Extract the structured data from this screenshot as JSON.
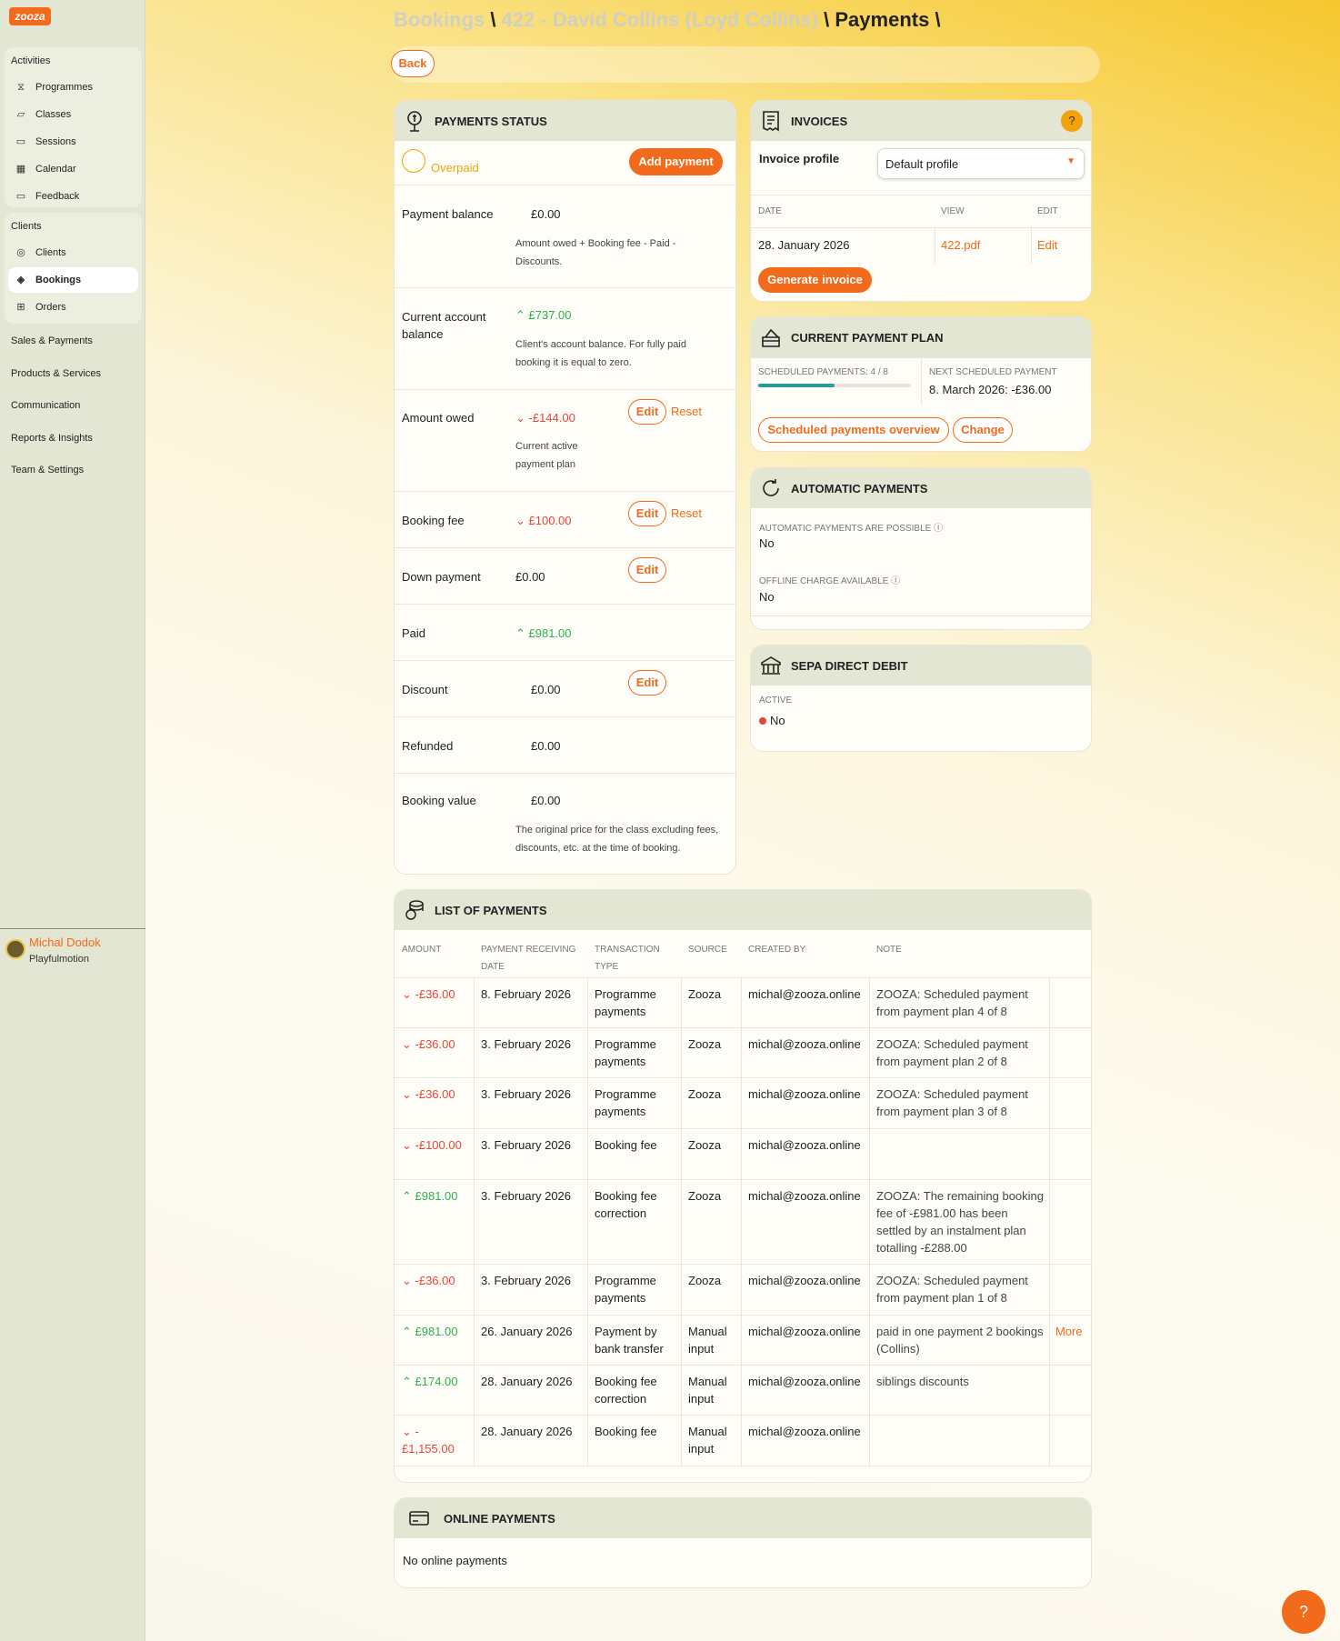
{
  "sidebar": {
    "logo": "zooza",
    "groups": [
      {
        "head": "Activities",
        "items": [
          "Programmes",
          "Classes",
          "Sessions",
          "Calendar",
          "Feedback"
        ]
      },
      {
        "head": "Clients",
        "items": [
          "Clients",
          "Bookings",
          "Orders"
        ]
      }
    ],
    "plain": [
      "Sales & Payments",
      "Products & Services",
      "Communication",
      "Reports & Insights",
      "Team & Settings"
    ],
    "user_name": "Michal Dodok",
    "user_org": "Playfulmotion"
  },
  "breadcrumbs": {
    "part1": "Bookings",
    "sep1": "\\",
    "part2": "422 - David Collins (Loyd Collins)",
    "sep2": "\\",
    "part3": "Payments",
    "sep3": "\\"
  },
  "back_label": "Back",
  "payments_status": {
    "title": "PAYMENTS STATUS",
    "status": "Overpaid",
    "add_payment": "Add payment",
    "rows": {
      "balance": {
        "label": "Payment balance",
        "value": "£0.00",
        "note": "Amount owed + Booking fee - Paid - Discounts."
      },
      "account": {
        "label": "Current account balance",
        "value": "£737.00",
        "note": "Client's account balance. For fully paid booking it is equal to zero."
      },
      "owed": {
        "label": "Amount owed",
        "value": "-£144.00",
        "note": "Current active payment plan",
        "edit": "Edit",
        "reset": "Reset"
      },
      "fee": {
        "label": "Booking fee",
        "value": "£100.00",
        "edit": "Edit",
        "reset": "Reset"
      },
      "down": {
        "label": "Down payment",
        "value": "£0.00",
        "edit": "Edit"
      },
      "paid": {
        "label": "Paid",
        "value": "£981.00"
      },
      "discount": {
        "label": "Discount",
        "value": "£0.00",
        "edit": "Edit"
      },
      "refunded": {
        "label": "Refunded",
        "value": "£0.00"
      },
      "value": {
        "label": "Booking value",
        "value": "£0.00",
        "note": "The original price for the class excluding fees, discounts, etc. at the time of booking."
      }
    }
  },
  "invoices": {
    "title": "INVOICES",
    "help": "?",
    "profile_label": "Invoice profile",
    "profile_value": "Default profile",
    "col_date": "DATE",
    "col_view": "VIEW",
    "col_edit": "EDIT",
    "date": "28. January 2026",
    "view": "422.pdf",
    "edit": "Edit",
    "generate": "Generate invoice"
  },
  "plan": {
    "title": "CURRENT PAYMENT PLAN",
    "scheduled_label": "SCHEDULED PAYMENTS: 4 / 8",
    "progress": 0.5,
    "next_label": "NEXT SCHEDULED PAYMENT",
    "next_value": "8. March 2026: -£36.00",
    "overview": "Scheduled payments overview",
    "change": "Change"
  },
  "auto": {
    "title": "AUTOMATIC PAYMENTS",
    "possible_label": "AUTOMATIC PAYMENTS ARE POSSIBLE",
    "possible_value": "No",
    "offline_label": "OFFLINE CHARGE AVAILABLE",
    "offline_value": "No"
  },
  "sepa": {
    "title": "SEPA DIRECT DEBIT",
    "active_label": "ACTIVE",
    "active_value": "No"
  },
  "list": {
    "title": "LIST OF PAYMENTS",
    "headers": {
      "amount": "AMOUNT",
      "date": "PAYMENT RECEIVING DATE",
      "type": "TRANSACTION TYPE",
      "source": "SOURCE",
      "created": "CREATED BY",
      "note": "NOTE"
    },
    "rows": [
      {
        "amount": "-£36.00",
        "date": "8. February 2026",
        "type": "Programme payments",
        "source": "Zooza",
        "created": "michal@zooza.online",
        "note": "ZOOZA: Scheduled payment from payment plan 4 of 8",
        "more": ""
      },
      {
        "amount": "-£36.00",
        "date": "3. February 2026",
        "type": "Programme payments",
        "source": "Zooza",
        "created": "michal@zooza.online",
        "note": "ZOOZA: Scheduled payment from payment plan 2 of 8",
        "more": ""
      },
      {
        "amount": "-£36.00",
        "date": "3. February 2026",
        "type": "Programme payments",
        "source": "Zooza",
        "created": "michal@zooza.online",
        "note": "ZOOZA: Scheduled payment from payment plan 3 of 8",
        "more": ""
      },
      {
        "amount": "-£100.00",
        "date": "3. February 2026",
        "type": "Booking fee",
        "source": "Zooza",
        "created": "michal@zooza.online",
        "note": "",
        "more": ""
      },
      {
        "amount": "£981.00",
        "date": "3. February 2026",
        "type": "Booking fee correction",
        "source": "Zooza",
        "created": "michal@zooza.online",
        "note": "ZOOZA: The remaining booking fee of -£981.00 has been settled by an instalment plan totalling -£288.00",
        "more": ""
      },
      {
        "amount": "-£36.00",
        "date": "3. February 2026",
        "type": "Programme payments",
        "source": "Zooza",
        "created": "michal@zooza.online",
        "note": "ZOOZA: Scheduled payment from payment plan 1 of 8",
        "more": ""
      },
      {
        "amount": "£981.00",
        "date": "26. January 2026",
        "type": "Payment by bank transfer",
        "source": "Manual input",
        "created": "michal@zooza.online",
        "note": "paid in one payment 2 bookings (Collins)",
        "more": "More"
      },
      {
        "amount": "£174.00",
        "date": "28. January 2026",
        "type": "Booking fee correction",
        "source": "Manual input",
        "created": "michal@zooza.online",
        "note": "siblings discounts",
        "more": ""
      },
      {
        "amount": "-£1,155.00",
        "date": "28. January 2026",
        "type": "Booking fee",
        "source": "Manual input",
        "created": "michal@zooza.online",
        "note": "",
        "more": ""
      }
    ]
  },
  "online": {
    "title": "ONLINE PAYMENTS",
    "empty": "No online payments"
  },
  "help_fab": "?"
}
